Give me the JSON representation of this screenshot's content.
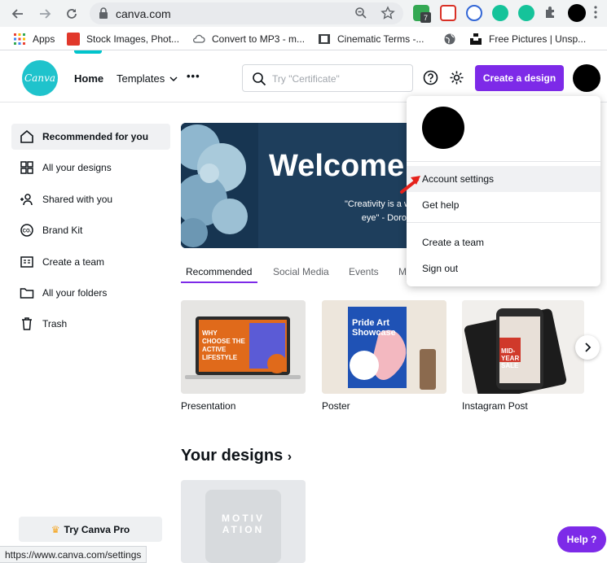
{
  "browser": {
    "url": "canva.com",
    "extension_badge": "7",
    "bookmarks": [
      {
        "label": "Apps"
      },
      {
        "label": "Stock Images, Phot..."
      },
      {
        "label": "Convert to MP3 - m..."
      },
      {
        "label": "Cinematic Terms -..."
      },
      {
        "label": ""
      },
      {
        "label": "Free Pictures | Unsp..."
      }
    ]
  },
  "header": {
    "logo_text": "Canva",
    "nav": {
      "home": "Home",
      "templates": "Templates",
      "more": "•••"
    },
    "search_placeholder": "Try \"Certificate\"",
    "create_button": "Create a design"
  },
  "sidebar": {
    "items": [
      {
        "label": "Recommended for you",
        "icon": "home-icon"
      },
      {
        "label": "All your designs",
        "icon": "grid-icon"
      },
      {
        "label": "Shared with you",
        "icon": "shared-users-icon"
      },
      {
        "label": "Brand Kit",
        "icon": "brand-kit-icon"
      },
      {
        "label": "Create a team",
        "icon": "team-icon"
      },
      {
        "label": "All your folders",
        "icon": "folder-icon"
      },
      {
        "label": "Trash",
        "icon": "trash-icon"
      }
    ],
    "try_pro": "Try Canva Pro"
  },
  "main": {
    "banner_title": "Welcome",
    "banner_quote_line1": "\"Creativity is a wild mind a",
    "banner_quote_line2": "eye\" - Dorothy Pa",
    "tabs": [
      {
        "label": "Recommended"
      },
      {
        "label": "Social Media"
      },
      {
        "label": "Events"
      },
      {
        "label": "M"
      }
    ],
    "cards": [
      {
        "label": "Presentation",
        "art_text": "WHY CHOOSE THE ACTIVE LIFESTYLE"
      },
      {
        "label": "Poster",
        "art_text": "Pride Art Showcase"
      },
      {
        "label": "Instagram Post",
        "art_text": "MID-YEAR SALE"
      }
    ],
    "your_designs": "Your designs",
    "design_thumb_text": "MOTIV ATION"
  },
  "dropdown": {
    "items": [
      {
        "label": "Account settings"
      },
      {
        "label": "Get help"
      },
      {
        "label": "Create a team"
      },
      {
        "label": "Sign out"
      }
    ]
  },
  "help_button": "Help ?",
  "status_url": "https://www.canva.com/settings",
  "colors": {
    "accent": "#7d2ae8",
    "logo": "#1fc3cc",
    "banner": "#1e3e5c"
  }
}
